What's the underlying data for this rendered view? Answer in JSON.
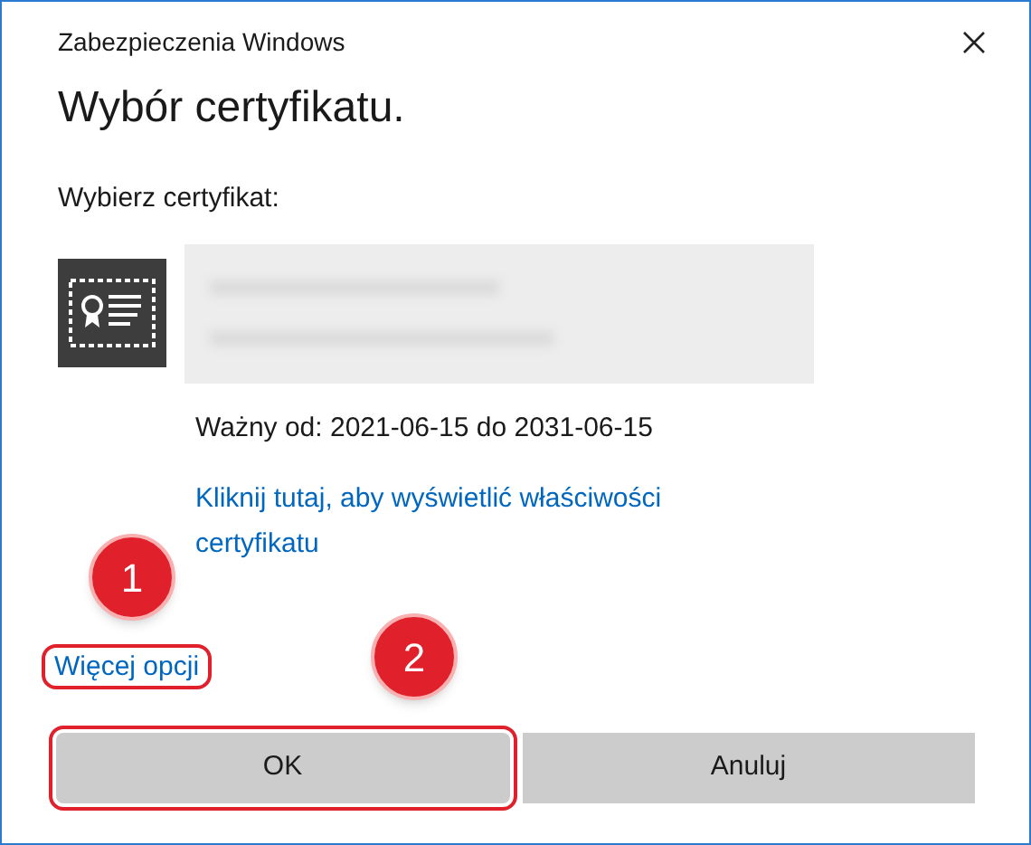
{
  "window": {
    "title": "Zabezpieczenia Windows"
  },
  "heading": "Wybór certyfikatu.",
  "prompt": "Wybierz certyfikat:",
  "certificate": {
    "validity": "Ważny od: 2021-06-15 do 2031-06-15",
    "properties_link": "Kliknij tutaj, aby wyświetlić właściwości certyfikatu"
  },
  "more_options": {
    "label": "Więcej opcji",
    "highlighted": true
  },
  "buttons": [
    {
      "label": "OK",
      "highlighted": true
    },
    {
      "label": "Anuluj",
      "highlighted": false
    }
  ],
  "annotations": [
    {
      "label": "1"
    },
    {
      "label": "2"
    }
  ]
}
